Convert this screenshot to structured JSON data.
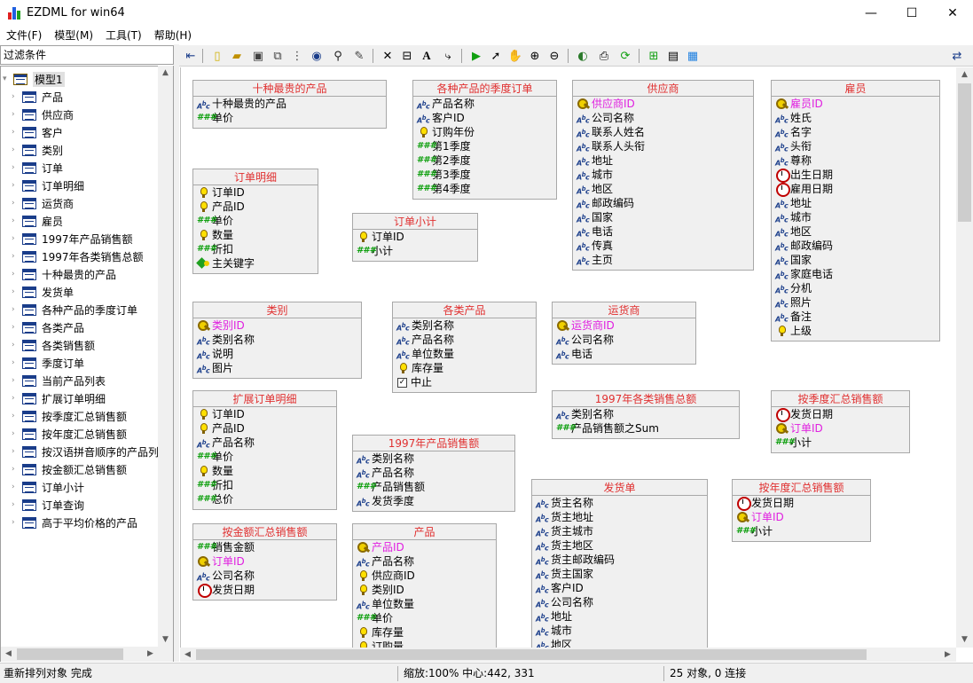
{
  "window": {
    "title": "EZDML for win64",
    "minimize": "—",
    "maximize": "☐",
    "close": "✕"
  },
  "menu": [
    "文件(F)",
    "模型(M)",
    "工具(T)",
    "帮助(H)"
  ],
  "filter": {
    "label": "过滤条件"
  },
  "tree": {
    "root": "模型1",
    "items": [
      "产品",
      "供应商",
      "客户",
      "类别",
      "订单",
      "订单明细",
      "运货商",
      "雇员",
      "1997年产品销售额",
      "1997年各类销售总额",
      "十种最贵的产品",
      "发货单",
      "各种产品的季度订单",
      "各类产品",
      "各类销售额",
      "季度订单",
      "当前产品列表",
      "扩展订单明细",
      "按季度汇总销售额",
      "按年度汇总销售额",
      "按汉语拼音顺序的产品列表",
      "按金额汇总销售额",
      "订单小计",
      "订单查询",
      "高于平均价格的产品"
    ]
  },
  "entities": [
    {
      "id": "e1",
      "title": "十种最贵的产品",
      "fields": [
        [
          "str",
          "十种最贵的产品"
        ],
        [
          "num",
          "单价"
        ]
      ]
    },
    {
      "id": "e2",
      "title": "各种产品的季度订单",
      "fields": [
        [
          "str",
          "产品名称"
        ],
        [
          "str",
          "客户ID"
        ],
        [
          "idx",
          "订购年份"
        ],
        [
          "num",
          "第1季度"
        ],
        [
          "num",
          "第2季度"
        ],
        [
          "num",
          "第3季度"
        ],
        [
          "num",
          "第4季度"
        ]
      ]
    },
    {
      "id": "e3",
      "title": "供应商",
      "fields": [
        [
          "key",
          "供应商ID"
        ],
        [
          "str",
          "公司名称"
        ],
        [
          "str",
          "联系人姓名"
        ],
        [
          "str",
          "联系人头衔"
        ],
        [
          "str",
          "地址"
        ],
        [
          "str",
          "城市"
        ],
        [
          "str",
          "地区"
        ],
        [
          "str",
          "邮政编码"
        ],
        [
          "str",
          "国家"
        ],
        [
          "str",
          "电话"
        ],
        [
          "str",
          "传真"
        ],
        [
          "str",
          "主页"
        ]
      ]
    },
    {
      "id": "e4",
      "title": "雇员",
      "fields": [
        [
          "key",
          "雇员ID"
        ],
        [
          "str",
          "姓氏"
        ],
        [
          "str",
          "名字"
        ],
        [
          "str",
          "头衔"
        ],
        [
          "str",
          "尊称"
        ],
        [
          "date",
          "出生日期"
        ],
        [
          "date",
          "雇用日期"
        ],
        [
          "str",
          "地址"
        ],
        [
          "str",
          "城市"
        ],
        [
          "str",
          "地区"
        ],
        [
          "str",
          "邮政编码"
        ],
        [
          "str",
          "国家"
        ],
        [
          "str",
          "家庭电话"
        ],
        [
          "str",
          "分机"
        ],
        [
          "str",
          "照片"
        ],
        [
          "str",
          "备注"
        ],
        [
          "idx",
          "上级"
        ]
      ]
    },
    {
      "id": "e5",
      "title": "订单明细",
      "fields": [
        [
          "idx",
          "订单ID"
        ],
        [
          "idx",
          "产品ID"
        ],
        [
          "num",
          "单价"
        ],
        [
          "idx",
          "数量"
        ],
        [
          "num",
          "折扣"
        ],
        [
          "fk",
          "主关键字"
        ]
      ]
    },
    {
      "id": "e6",
      "title": "订单小计",
      "fields": [
        [
          "idx",
          "订单ID"
        ],
        [
          "num",
          "小计"
        ]
      ]
    },
    {
      "id": "e7",
      "title": "类别",
      "fields": [
        [
          "key",
          "类别ID"
        ],
        [
          "str",
          "类别名称"
        ],
        [
          "str",
          "说明"
        ],
        [
          "str",
          "图片"
        ]
      ]
    },
    {
      "id": "e8",
      "title": "各类产品",
      "fields": [
        [
          "str",
          "类别名称"
        ],
        [
          "str",
          "产品名称"
        ],
        [
          "str",
          "单位数量"
        ],
        [
          "idx",
          "库存量"
        ],
        [
          "chk",
          "中止"
        ]
      ]
    },
    {
      "id": "e9",
      "title": "运货商",
      "fields": [
        [
          "key",
          "运货商ID"
        ],
        [
          "str",
          "公司名称"
        ],
        [
          "str",
          "电话"
        ]
      ]
    },
    {
      "id": "e10",
      "title": "扩展订单明细",
      "fields": [
        [
          "idx",
          "订单ID"
        ],
        [
          "idx",
          "产品ID"
        ],
        [
          "str",
          "产品名称"
        ],
        [
          "num",
          "单价"
        ],
        [
          "idx",
          "数量"
        ],
        [
          "num",
          "折扣"
        ],
        [
          "num",
          "总价"
        ]
      ]
    },
    {
      "id": "e11",
      "title": "1997年各类销售总额",
      "fields": [
        [
          "str",
          "类别名称"
        ],
        [
          "num",
          "产品销售额之Sum"
        ]
      ]
    },
    {
      "id": "e12",
      "title": "按季度汇总销售额",
      "fields": [
        [
          "date",
          "发货日期"
        ],
        [
          "key",
          "订单ID"
        ],
        [
          "num",
          "小计"
        ]
      ]
    },
    {
      "id": "e13",
      "title": "1997年产品销售额",
      "fields": [
        [
          "str",
          "类别名称"
        ],
        [
          "str",
          "产品名称"
        ],
        [
          "num",
          "产品销售额"
        ],
        [
          "str",
          "发货季度"
        ]
      ]
    },
    {
      "id": "e14",
      "title": "发货单",
      "fields": [
        [
          "str",
          "货主名称"
        ],
        [
          "str",
          "货主地址"
        ],
        [
          "str",
          "货主城市"
        ],
        [
          "str",
          "货主地区"
        ],
        [
          "str",
          "货主邮政编码"
        ],
        [
          "str",
          "货主国家"
        ],
        [
          "str",
          "客户ID"
        ],
        [
          "str",
          "公司名称"
        ],
        [
          "str",
          "地址"
        ],
        [
          "str",
          "城市"
        ],
        [
          "str",
          "地区"
        ]
      ]
    },
    {
      "id": "e15",
      "title": "按年度汇总销售额",
      "fields": [
        [
          "date",
          "发货日期"
        ],
        [
          "key",
          "订单ID"
        ],
        [
          "num",
          "小计"
        ]
      ]
    },
    {
      "id": "e16",
      "title": "按金额汇总销售额",
      "fields": [
        [
          "num",
          "销售金额"
        ],
        [
          "key",
          "订单ID"
        ],
        [
          "str",
          "公司名称"
        ],
        [
          "date",
          "发货日期"
        ]
      ]
    },
    {
      "id": "e17",
      "title": "产品",
      "fields": [
        [
          "key",
          "产品ID"
        ],
        [
          "str",
          "产品名称"
        ],
        [
          "idx",
          "供应商ID"
        ],
        [
          "idx",
          "类别ID"
        ],
        [
          "str",
          "单位数量"
        ],
        [
          "num",
          "单价"
        ],
        [
          "idx",
          "库存量"
        ],
        [
          "idx",
          "订购量"
        ]
      ]
    }
  ],
  "status": {
    "left": "重新排列对象 完成",
    "zoom": "缩放:100% 中心:442, 331",
    "count": "25 对象, 0 连接"
  }
}
